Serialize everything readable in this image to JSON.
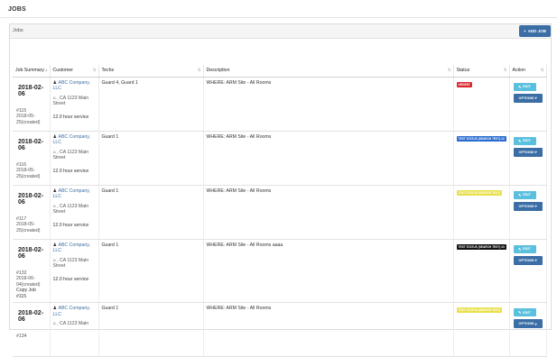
{
  "page": {
    "title": "JOBS"
  },
  "panel": {
    "title": "Jobs",
    "add_button": "ADD JOB"
  },
  "columns": [
    "Job Summary",
    "Customer",
    "Techs",
    "Description",
    "Status",
    "Action"
  ],
  "action": {
    "edit": "EDIT",
    "options": "OPTIONS"
  },
  "rows": [
    {
      "date": "2018-02-06",
      "number": "#115",
      "created_date": "2018-05-",
      "created_label": "25(created)",
      "extra": "",
      "customer": "ABC Company,",
      "customer2": "LLC",
      "addr1": ", CA 1123 Main",
      "addr2": "Street",
      "service": "12.0 hour service",
      "techs": "Guard 4, Guard 1",
      "description": "WHERE: ARM Site - All Rooms",
      "status": "URGENT",
      "status_style": "red"
    },
    {
      "date": "2018-02-06",
      "number": "#116",
      "created_date": "2018-05-",
      "created_label": "25(created)",
      "extra": "",
      "customer": "ABC Company,",
      "customer2": "LLC",
      "addr1": ", CA 1123 Main",
      "addr2": "Street",
      "service": "12.0 hour service",
      "techs": "Guard 1",
      "description": "WHERE: ARM Site - All Rooms",
      "status": "TEST STATUS (SEARCH TEST) #2",
      "status_style": "blue"
    },
    {
      "date": "2018-02-06",
      "number": "#117",
      "created_date": "2018-05-",
      "created_label": "25(created)",
      "extra": "",
      "customer": "ABC Company,",
      "customer2": "LLC",
      "addr1": ", CA 1123 Main",
      "addr2": "Street",
      "service": "12.0 hour service",
      "techs": "Guard 1",
      "description": "WHERE: ARM Site - All Rooms",
      "status": "TEST STATUS (SEARCH TEST)",
      "status_style": "yellow"
    },
    {
      "date": "2018-02-06",
      "number": "#132",
      "created_date": "2018-06-",
      "created_label": "04(created)",
      "extra": "Copy Job #115",
      "customer": "ABC Company,",
      "customer2": "LLC",
      "addr1": ", CA 1123 Main",
      "addr2": "Street",
      "service": "12.0 hour service",
      "techs": "Guard 1",
      "description": "WHERE: ARM Site - All Rooms aaaa",
      "status": "TEST STATUS (SEARCH TEST) #3",
      "status_style": "black"
    },
    {
      "date": "2018-02-06",
      "number": "#134",
      "created_date": "",
      "created_label": "",
      "extra": "",
      "customer": "ABC Company,",
      "customer2": "LLC",
      "addr1": ", CA 1123 Main",
      "addr2": "",
      "service": "",
      "techs": "Guard 1",
      "description": "WHERE: ARM Site - All Rooms",
      "status": "TEST STATUS (SEARCH TEST)",
      "status_style": "yellow"
    }
  ],
  "colors": {
    "link": "#3a6ea5",
    "primary": "#3a6ea5",
    "edit": "#5bc0de",
    "urgent": "#d9292f",
    "status_blue": "#2a6ccf",
    "status_yellow": "#e8e04a",
    "status_black": "#111111"
  },
  "icons": {
    "sort": "sort-icon",
    "person": "person-icon",
    "home": "home-icon",
    "edit": "edit-icon",
    "plus": "plus-icon",
    "caret": "caret-down-icon"
  }
}
